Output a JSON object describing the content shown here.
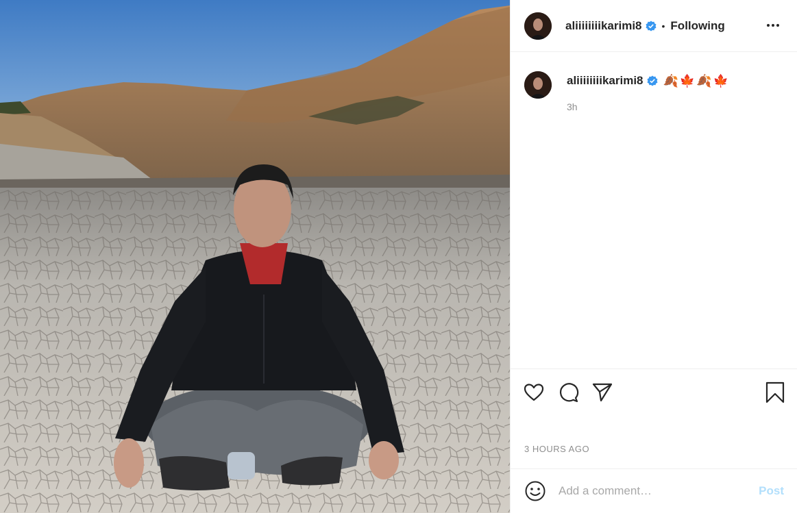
{
  "post": {
    "image_alt": "Man sitting cross-legged on cracked dry lakebed with mountains behind"
  },
  "header": {
    "username": "aliiiiiiiikarimi8",
    "separator": "•",
    "follow_status": "Following"
  },
  "caption": {
    "username": "aliiiiiiiikarimi8",
    "text": "🍂🍁🍂🍁",
    "time_ago": "3h"
  },
  "footer": {
    "timestamp": "3 HOURS AGO",
    "comment_placeholder": "Add a comment…",
    "post_label": "Post"
  },
  "colors": {
    "verified": "#3897f0",
    "post_disabled": "#b2dffc",
    "muted": "#8e8e8e"
  },
  "icons": [
    "heart-icon",
    "comment-icon",
    "share-icon",
    "bookmark-icon",
    "emoji-icon",
    "more-icon",
    "verified-badge-icon"
  ]
}
